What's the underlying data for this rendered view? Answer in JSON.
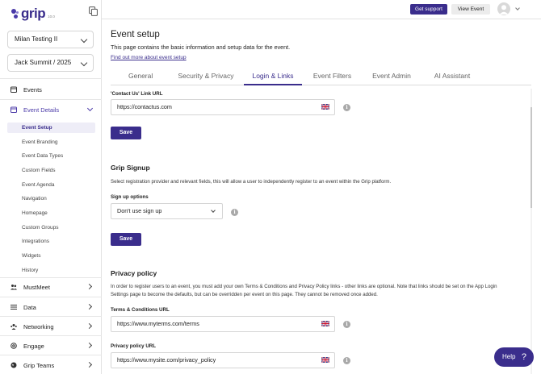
{
  "app": {
    "logo_text": "grip",
    "logo_sub": "10.0"
  },
  "sidebar": {
    "org_select": "Milan Testing II",
    "event_select": "Jack Summit / 2025",
    "nav": [
      {
        "label": "Events",
        "icon": "calendar-icon"
      },
      {
        "label": "Event Details",
        "icon": "calendar-icon"
      },
      {
        "label": "MustMeet",
        "icon": "users-icon"
      },
      {
        "label": "Data",
        "icon": "list-icon"
      },
      {
        "label": "Networking",
        "icon": "network-icon"
      },
      {
        "label": "Engage",
        "icon": "at-icon"
      },
      {
        "label": "Grip Teams",
        "icon": "globe-icon"
      }
    ],
    "sub_items": [
      "Event Setup",
      "Event Branding",
      "Event Data Types",
      "Custom Fields",
      "Event Agenda",
      "Navigation",
      "Homepage",
      "Custom Groups",
      "Integrations",
      "Widgets",
      "History"
    ]
  },
  "header": {
    "support_label": "Get support",
    "view_event_label": "View Event"
  },
  "page": {
    "title": "Event setup",
    "subtitle": "This page contains the basic information and setup data for the event.",
    "link": "Find out more about event setup",
    "tabs": [
      "General",
      "Security & Privacy",
      "Login & Links",
      "Event Filters",
      "Event Admin",
      "AI Assistant"
    ],
    "active_tab": "Login & Links"
  },
  "contact": {
    "label": "'Contact Us' Link URL",
    "value": "https://contactus.com",
    "save": "Save"
  },
  "signup": {
    "heading": "Grip Signup",
    "description": "Select registration provider and relevant fields, this will allow a user to independently register to an event within the Grip platform.",
    "options_label": "Sign up options",
    "selected": "Don't use sign up",
    "save": "Save"
  },
  "privacy": {
    "heading": "Privacy policy",
    "description": "In order to register users to an event, you must add your own Terms & Conditions and Privacy Policy links - other links are optional. Note that links should be set on the App Login Settings page to become the defaults, but can be overridden per event on this page. They cannot be removed once added.",
    "terms_label": "Terms & Conditions URL",
    "terms_value": "https://www.myterms.com/terms",
    "policy_label": "Privacy policy URL",
    "policy_value": "https://www.mysite.com/privacy_policy"
  },
  "help": {
    "label": "Help",
    "symbol": "?"
  },
  "colors": {
    "brand": "#3a2d8c",
    "active_bg": "#eeedf7"
  }
}
